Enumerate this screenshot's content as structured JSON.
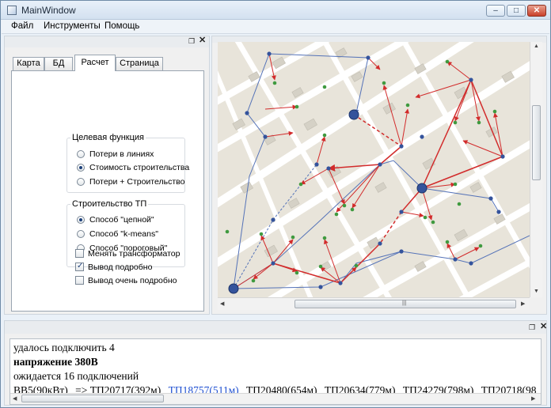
{
  "window": {
    "title": "MainWindow",
    "minimize": "–",
    "maximize": "□",
    "close": "✕"
  },
  "menu": {
    "file": "Файл",
    "tools": "Инструменты",
    "help": "Помощь"
  },
  "left_dock": {
    "float_icon": "float-icon",
    "close_icon": "close-icon",
    "tabs": [
      {
        "label": "Карта",
        "active": false
      },
      {
        "label": "БД",
        "active": false
      },
      {
        "label": "Расчет",
        "active": true
      },
      {
        "label": "Страница",
        "active": false
      }
    ],
    "target_group": {
      "title": "Целевая функция",
      "options": [
        {
          "label": "Потери в линиях",
          "checked": false
        },
        {
          "label": "Стоимость строительства",
          "checked": true
        },
        {
          "label": "Потери + Строительство",
          "checked": false
        }
      ]
    },
    "tp_group": {
      "title": "Строительство ТП",
      "options": [
        {
          "label": "Способ \"цепной\"",
          "checked": true
        },
        {
          "label": "Способ \"k-means\"",
          "checked": false
        },
        {
          "label": "Способ \"пороговый\"",
          "checked": false
        }
      ]
    },
    "checkboxes": [
      {
        "label": "Менять трансформатор",
        "checked": false
      },
      {
        "label": "Вывод подробно",
        "checked": true
      },
      {
        "label": "Вывод очень подробно",
        "checked": false
      }
    ]
  },
  "map": {
    "colors": {
      "background": "#e8e4da",
      "road": "#ffffff",
      "building": "#d5d1c6",
      "red_line": "#d22b2b",
      "blue_line": "#5573b8",
      "node": "#34539c",
      "consumer": "#3f9a3f"
    }
  },
  "log": {
    "line1": "удалось подключить 4",
    "line2": "напряжение 380В",
    "line3": "ожидается 16 подключений",
    "line4": [
      {
        "text": "ВВ5(90кВт)",
        "style": "normal"
      },
      {
        "text": "=> ТП20717(392м)",
        "style": "normal"
      },
      {
        "text": "ТП18757(511м)",
        "style": "blue"
      },
      {
        "text": "ТП20480(654м)",
        "style": "normal"
      },
      {
        "text": "ТП20634(779м)",
        "style": "normal"
      },
      {
        "text": "ТП24279(798м)",
        "style": "normal"
      },
      {
        "text": "ТП20718(98",
        "style": "normal"
      }
    ]
  }
}
